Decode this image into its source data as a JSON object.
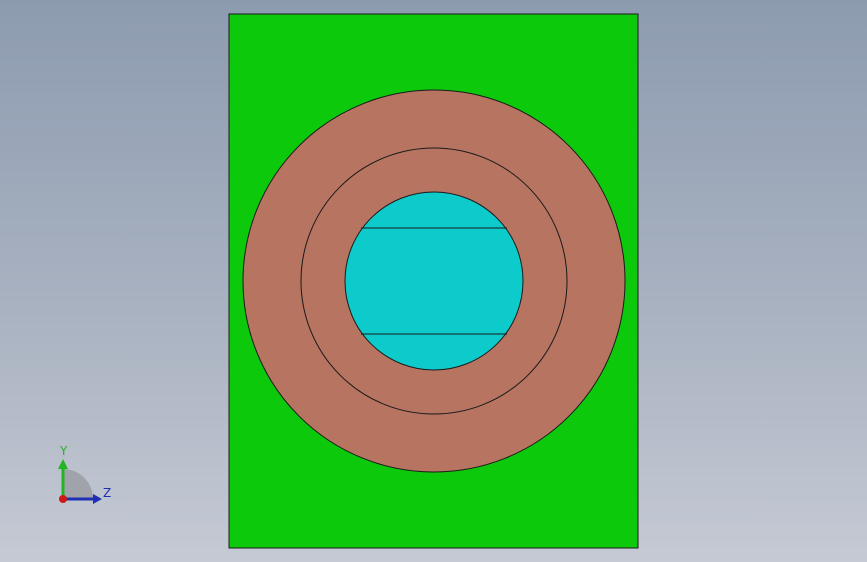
{
  "viewport": {
    "background_top": "#8d9bb0",
    "background_bottom": "#c5cad4"
  },
  "part": {
    "plate_color": "#0cc90c",
    "ring_color": "#b77461",
    "bore_color": "#0ecbcb",
    "edge_color": "#1a1a1a"
  },
  "triad": {
    "y_label": "Y",
    "z_label": "Z",
    "y_color": "#22b522",
    "z_color": "#1f2fb3",
    "origin_color": "#d01818"
  }
}
